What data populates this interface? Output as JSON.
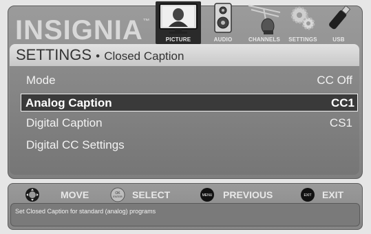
{
  "brand": {
    "name": "INSIGNIA",
    "tm": "™"
  },
  "tabs": [
    {
      "id": "picture",
      "label": "PICTURE",
      "icon": "picture-icon",
      "active": true
    },
    {
      "id": "audio",
      "label": "AUDIO",
      "icon": "speaker-icon",
      "active": false
    },
    {
      "id": "channels",
      "label": "CHANNELS",
      "icon": "antenna-icon",
      "active": false
    },
    {
      "id": "settings",
      "label": "SETTINGS",
      "icon": "gears-icon",
      "active": false
    },
    {
      "id": "usb",
      "label": "USB",
      "icon": "usb-stick-icon",
      "active": false
    }
  ],
  "header": {
    "title": "SETTINGS",
    "separator": "•",
    "subtitle": "Closed Caption"
  },
  "menu": [
    {
      "label": "Mode",
      "value": "CC Off",
      "selected": false
    },
    {
      "label": "Analog Caption",
      "value": "CC1",
      "selected": true
    },
    {
      "label": "Digital Caption",
      "value": "CS1",
      "selected": false
    },
    {
      "label": "Digital CC Settings",
      "value": "",
      "selected": false
    }
  ],
  "hints": [
    {
      "label": "MOVE",
      "icon": "dpad-icon",
      "icon_text": ""
    },
    {
      "label": "SELECT",
      "icon": "ok-enter-button-icon",
      "icon_text": "OK ENTER"
    },
    {
      "label": "PREVIOUS",
      "icon": "menu-button-icon",
      "icon_text": "MENU"
    },
    {
      "label": "EXIT",
      "icon": "exit-button-icon",
      "icon_text": "EXIT"
    }
  ],
  "status": {
    "text": "Set Closed Caption for standard (analog) programs"
  },
  "colors": {
    "panel": "#8a8a8a",
    "header_bar": "#d6d6d6",
    "selected_row": "#3a3a3a",
    "text": "#f2f2f2"
  }
}
